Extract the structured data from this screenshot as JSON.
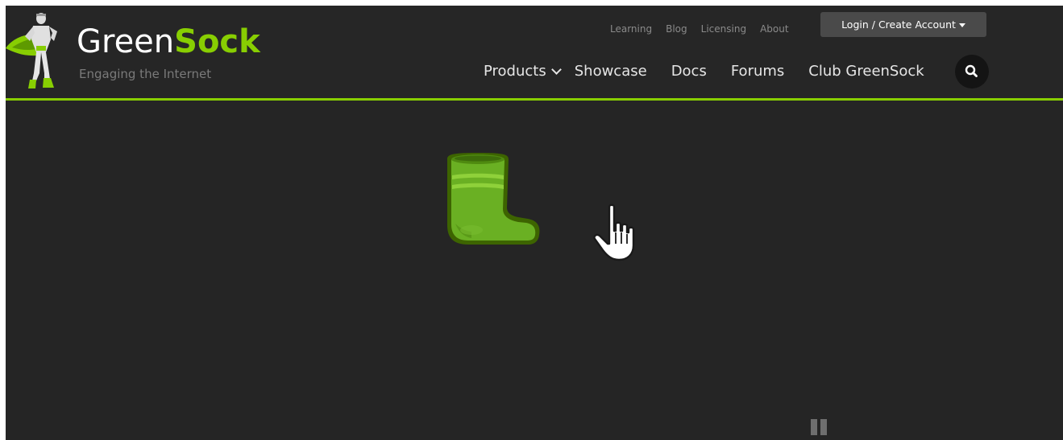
{
  "logo": {
    "word_green": "Green",
    "word_sock": "Sock",
    "tagline": "Engaging the Internet"
  },
  "utility_nav": [
    "Learning",
    "Blog",
    "Licensing",
    "About"
  ],
  "login_button": "Login / Create Account",
  "main_nav": {
    "products": "Products",
    "showcase": "Showcase",
    "docs": "Docs",
    "forums": "Forums",
    "club": "Club GreenSock"
  },
  "icons": {
    "search": "search-icon",
    "products_dropdown": "chevron-down-icon",
    "login_dropdown": "caret-down-icon",
    "hero": "sock-icon",
    "cursor": "hand-pointer-icon",
    "player": "pause-icon"
  },
  "colors": {
    "brand_green": "#88ce02",
    "background": "#252525",
    "header_background": "#262626",
    "nav_text": "#e6e6e6",
    "utility_text": "#8a8a8a",
    "button_background": "#4a4a4a"
  }
}
